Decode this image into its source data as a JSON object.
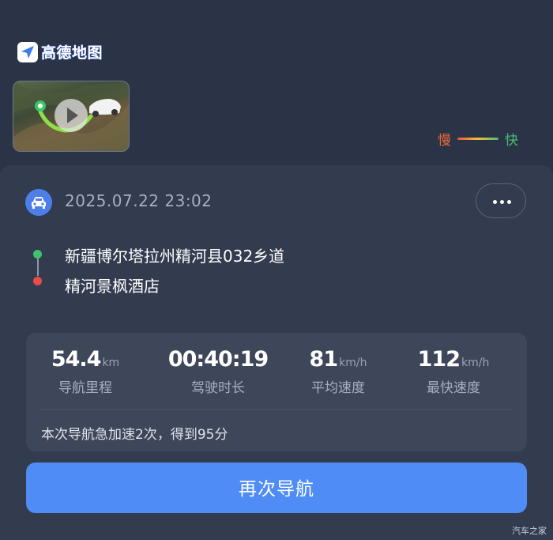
{
  "header": {
    "logo_text": "高德地图",
    "speed_legend": {
      "slow": "慢",
      "fast": "快"
    }
  },
  "trip": {
    "datetime": "2025.07.22 23:02",
    "route": {
      "start": "新疆博尔塔拉州精河县032乡道",
      "end": "精河景枫酒店"
    },
    "stats": [
      {
        "value": "54.4",
        "unit": "km",
        "label": "导航里程"
      },
      {
        "value": "00:40:19",
        "unit": "",
        "label": "驾驶时长"
      },
      {
        "value": "81",
        "unit": "km/h",
        "label": "平均速度"
      },
      {
        "value": "112",
        "unit": "km/h",
        "label": "最快速度"
      }
    ],
    "note": "本次导航急加速2次，得到95分",
    "renavigate_label": "再次导航"
  },
  "watermark": "汽车之家",
  "colors": {
    "accent": "#4f8cf5",
    "start_dot": "#3cc46b",
    "end_dot": "#e94a4a",
    "slow": "#e8683a",
    "fast": "#4dbb74"
  }
}
